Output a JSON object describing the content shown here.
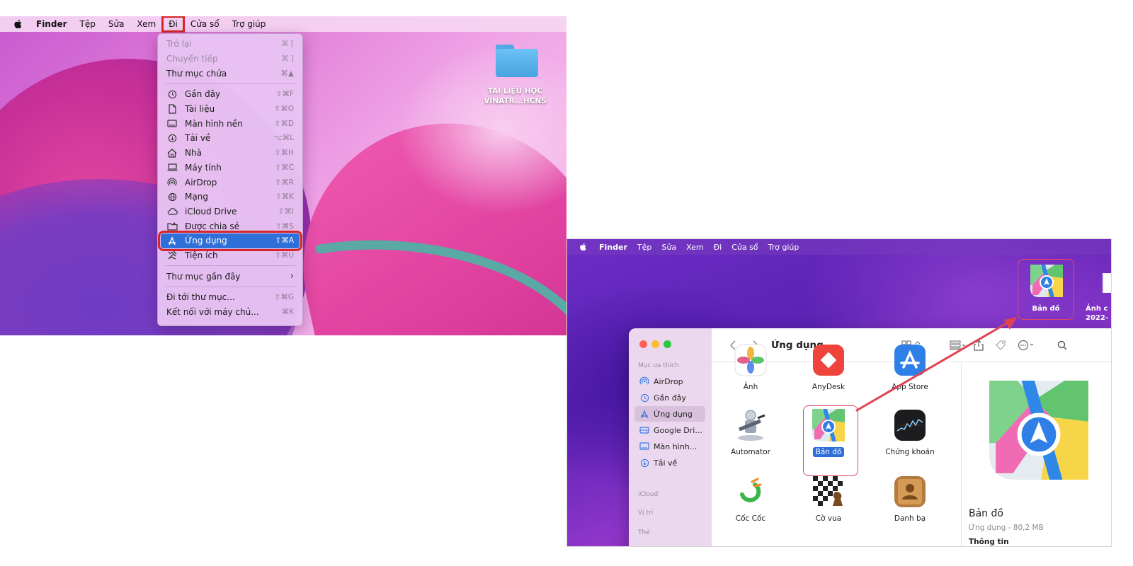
{
  "colors": {
    "highlight_red": "#d62626",
    "selection_blue": "#2f6fd8",
    "arrow_teal": "#5aa9a4",
    "arrow_red": "#e0424f"
  },
  "screenshot1": {
    "menubar": {
      "app": "Finder",
      "items": [
        "Tệp",
        "Sửa",
        "Xem",
        "Đi",
        "Cửa sổ",
        "Trợ giúp"
      ],
      "highlighted": "Đi"
    },
    "desktop_folder_label_line1": "TÀI LIỆU HỌC",
    "desktop_folder_label_line2": "VINATR...HCNS",
    "go_menu": [
      {
        "label": "Trở lại",
        "shortcut": "⌘ [",
        "disabled": true,
        "icon": ""
      },
      {
        "label": "Chuyển tiếp",
        "shortcut": "⌘ ]",
        "disabled": true,
        "icon": ""
      },
      {
        "label": "Thư mục chứa",
        "shortcut": "⌘▲",
        "icon": ""
      },
      {
        "sep": true
      },
      {
        "label": "Gần đây",
        "shortcut": "⇧⌘F",
        "icon": "clock-icon"
      },
      {
        "label": "Tài liệu",
        "shortcut": "⇧⌘O",
        "icon": "document-icon"
      },
      {
        "label": "Màn hình nền",
        "shortcut": "⇧⌘D",
        "icon": "desktop-icon"
      },
      {
        "label": "Tải về",
        "shortcut": "⌥⌘L",
        "icon": "download-icon"
      },
      {
        "label": "Nhà",
        "shortcut": "⇧⌘H",
        "icon": "home-icon"
      },
      {
        "label": "Máy tính",
        "shortcut": "⇧⌘C",
        "icon": "laptop-icon"
      },
      {
        "label": "AirDrop",
        "shortcut": "⇧⌘R",
        "icon": "airdrop-icon"
      },
      {
        "label": "Mạng",
        "shortcut": "⇧⌘K",
        "icon": "network-icon"
      },
      {
        "label": "iCloud Drive",
        "shortcut": "⇧⌘I",
        "icon": "cloud-icon"
      },
      {
        "label": "Được chia sẻ",
        "shortcut": "⇧⌘S",
        "icon": "shared-folder-icon"
      },
      {
        "label": "Ứng dụng",
        "shortcut": "⇧⌘A",
        "icon": "applications-icon",
        "active": true
      },
      {
        "label": "Tiện ích",
        "shortcut": "⇧⌘U",
        "icon": "utilities-icon"
      },
      {
        "sep": true
      },
      {
        "label": "Thư mục gần đây",
        "shortcut": "",
        "submenu": true,
        "icon": ""
      },
      {
        "sep": true
      },
      {
        "label": "Đi tới thư mục...",
        "shortcut": "⇧⌘G",
        "icon": ""
      },
      {
        "label": "Kết nối với máy chủ...",
        "shortcut": "⌘K",
        "icon": ""
      }
    ]
  },
  "screenshot2": {
    "menubar": {
      "app": "Finder",
      "items": [
        "Tệp",
        "Sửa",
        "Xem",
        "Đi",
        "Cửa sổ",
        "Trợ giúp"
      ]
    },
    "desktop_maps_label": "Bản đồ",
    "desktop_partial_line1": "Ảnh c",
    "desktop_partial_line2": "2022-",
    "finder": {
      "title": "Ứng dụng",
      "sidebar": {
        "favorites_header": "Mục ưa thích",
        "items": [
          {
            "label": "AirDrop",
            "icon": "airdrop-icon"
          },
          {
            "label": "Gần đây",
            "icon": "clock-icon"
          },
          {
            "label": "Ứng dụng",
            "icon": "applications-icon",
            "selected": true
          },
          {
            "label": "Google Dri...",
            "icon": "drive-icon"
          },
          {
            "label": "Màn hình...",
            "icon": "desktop-icon"
          },
          {
            "label": "Tải về",
            "icon": "download-icon"
          }
        ],
        "icloud_header": "iCloud",
        "location_header": "Vị trí",
        "tags_header": "Thẻ"
      },
      "apps": [
        {
          "name": "Ảnh",
          "icon": "photos-icon"
        },
        {
          "name": "AnyDesk",
          "icon": "anydesk-icon"
        },
        {
          "name": "App Store",
          "icon": "app-store-icon"
        },
        {
          "name": "Automator",
          "icon": "automator-icon"
        },
        {
          "name": "Bản đồ",
          "icon": "maps-icon",
          "selected": true
        },
        {
          "name": "Chứng khoán",
          "icon": "stocks-icon"
        },
        {
          "name": "Cốc Cốc",
          "icon": "coccoc-icon"
        },
        {
          "name": "Cờ vua",
          "icon": "chess-icon"
        },
        {
          "name": "Danh bạ",
          "icon": "contacts-icon"
        }
      ],
      "preview": {
        "name": "Bản đồ",
        "meta": "Ứng dụng - 80,2 MB",
        "info": "Thông tin"
      }
    }
  }
}
